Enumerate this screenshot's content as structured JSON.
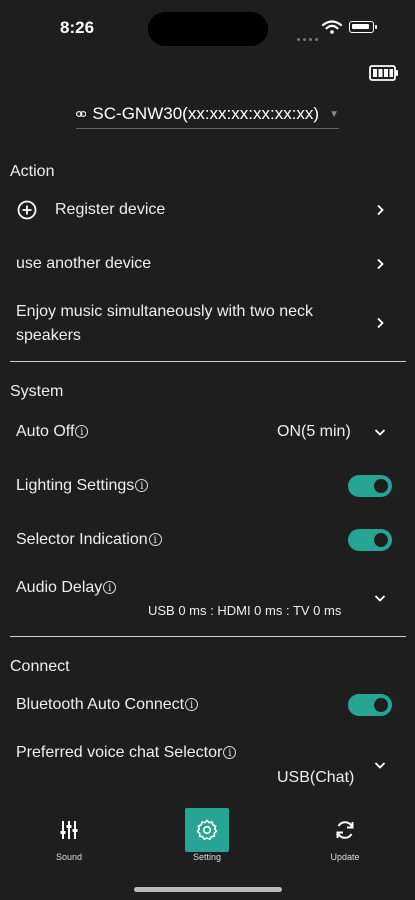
{
  "status_bar": {
    "time": "8:26"
  },
  "device_selector": {
    "name": "SC-GNW30(xx:xx:xx:xx:xx:xx)"
  },
  "action": {
    "heading": "Action",
    "register_device": "Register device",
    "use_another_device": "use another device",
    "enjoy_music": "Enjoy music simultaneously with two neck speakers"
  },
  "system": {
    "heading": "System",
    "auto_off": {
      "label": "Auto Off",
      "value": "ON(5 min)"
    },
    "lighting_settings": {
      "label": "Lighting Settings",
      "enabled": true
    },
    "selector_indication": {
      "label": "Selector Indication",
      "enabled": true
    },
    "audio_delay": {
      "label": "Audio Delay",
      "value": "USB 0 ms : HDMI 0 ms : TV 0 ms"
    }
  },
  "connect": {
    "heading": "Connect",
    "bluetooth_auto_connect": {
      "label": "Bluetooth Auto Connect",
      "enabled": true
    },
    "preferred_voice_chat": {
      "label": "Preferred voice chat Selector",
      "value": "USB(Chat)"
    }
  },
  "tabs": [
    {
      "label": "Sound",
      "icon": "equalizer-icon",
      "active": false
    },
    {
      "label": "Setting",
      "icon": "gear-icon",
      "active": true
    },
    {
      "label": "Update",
      "icon": "refresh-icon",
      "active": false
    }
  ],
  "colors": {
    "accent": "#27a594",
    "background": "#1e1e1e",
    "text": "#ededed"
  },
  "info_glyph": "i"
}
